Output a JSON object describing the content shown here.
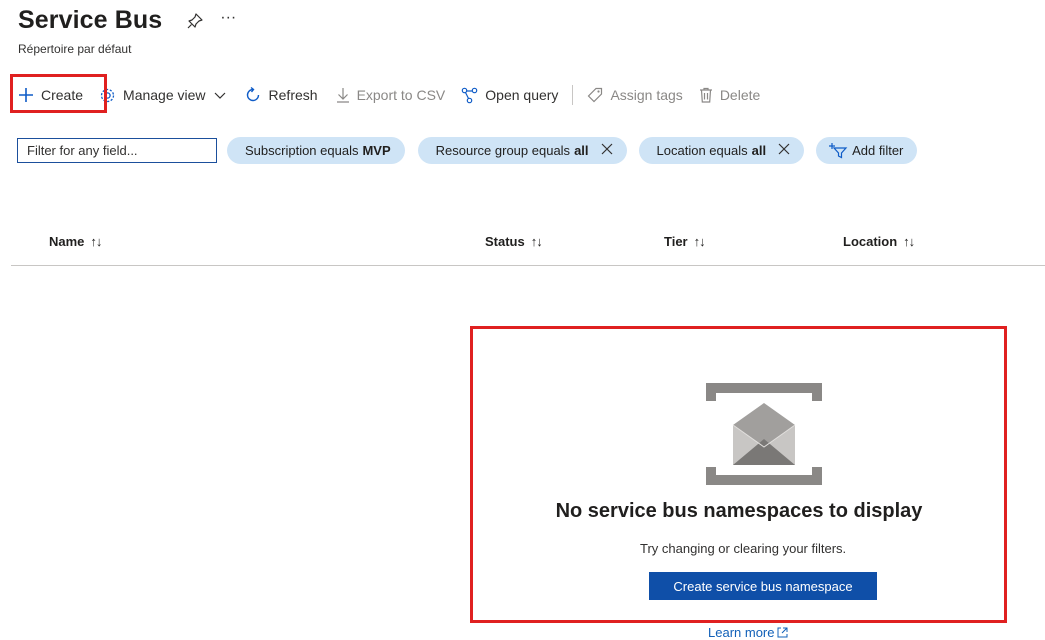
{
  "header": {
    "title": "Service Bus",
    "more_label": "···",
    "subtitle": "Répertoire par défaut"
  },
  "toolbar": {
    "create": "Create",
    "manage_view": "Manage view",
    "refresh": "Refresh",
    "export_csv": "Export to CSV",
    "open_query": "Open query",
    "assign_tags": "Assign tags",
    "delete": "Delete"
  },
  "filters": {
    "search_placeholder": "Filter for any field...",
    "pills": [
      {
        "label": "Subscription equals",
        "value": "MVP"
      },
      {
        "label": "Resource group equals",
        "value": "all"
      },
      {
        "label": "Location equals",
        "value": "all"
      }
    ],
    "add_filter": "Add filter"
  },
  "table": {
    "columns": [
      {
        "label": "Name",
        "sort": "↑↓"
      },
      {
        "label": "Status",
        "sort": "↑↓"
      },
      {
        "label": "Tier",
        "sort": "↑↓"
      },
      {
        "label": "Location",
        "sort": "↑↓"
      }
    ]
  },
  "empty_state": {
    "title": "No service bus namespaces to display",
    "subtitle": "Try changing or clearing your filters.",
    "button": "Create service bus namespace",
    "link": "Learn more"
  },
  "colors": {
    "accent": "#0f4fa8",
    "pill_bg": "#cfe4f6",
    "highlight": "#e02020",
    "link": "#1160b8"
  }
}
